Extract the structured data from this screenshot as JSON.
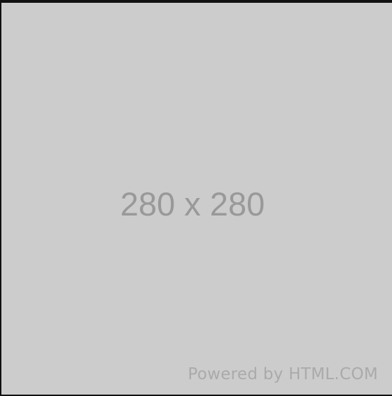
{
  "placeholder": {
    "dimensions_label": "280 x 280",
    "powered_by": "Powered by HTML.COM"
  },
  "colors": {
    "background": "#cccccc",
    "label": "#999999",
    "credit": "#aaaaaa",
    "border": "#111111"
  }
}
